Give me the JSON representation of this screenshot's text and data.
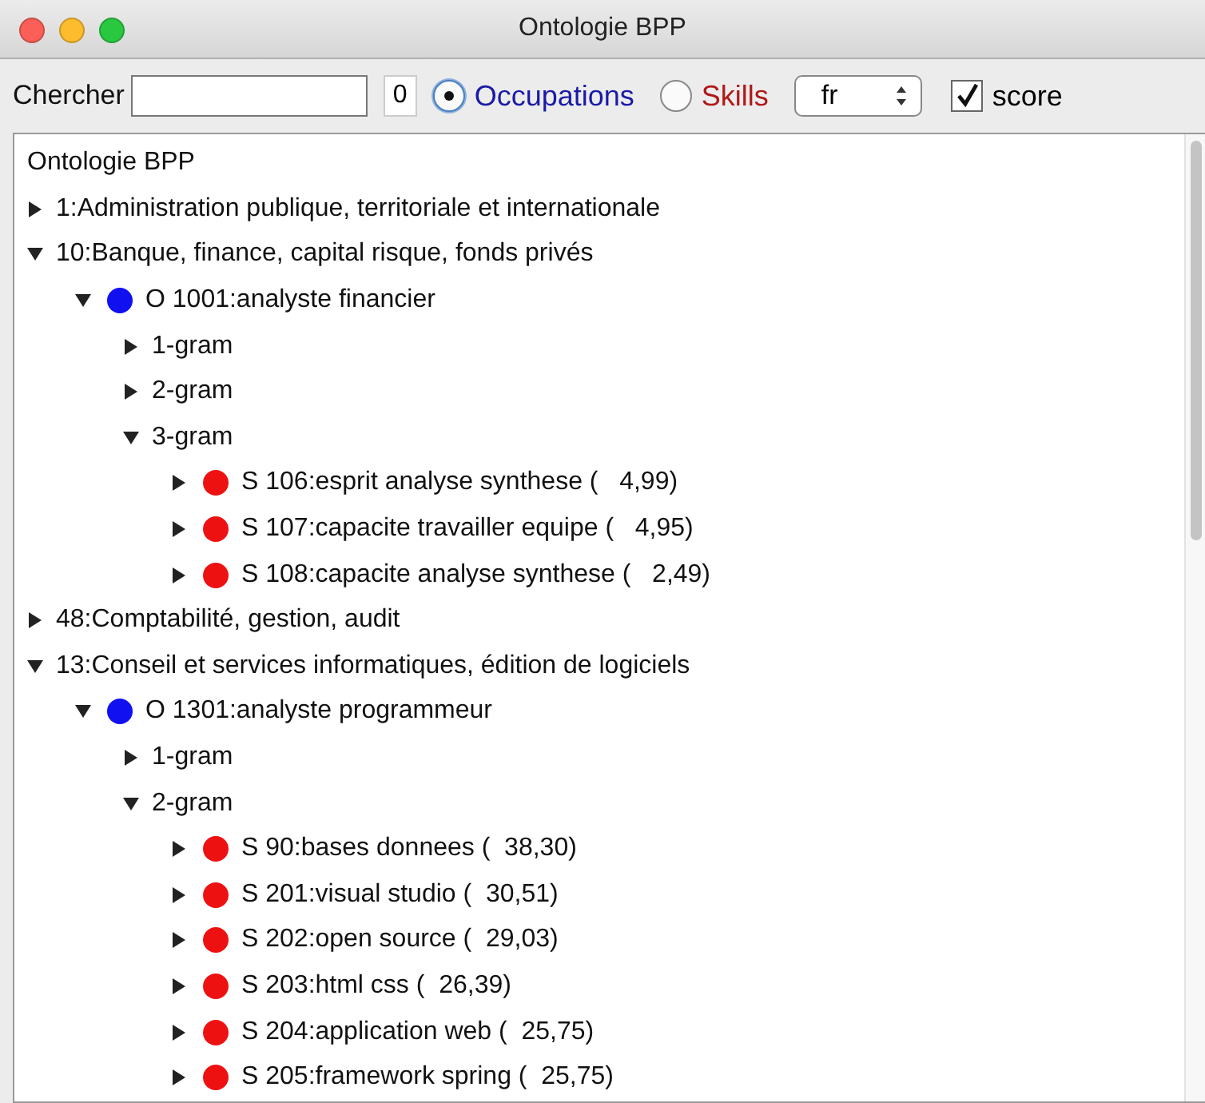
{
  "window": {
    "title": "Ontologie BPP"
  },
  "toolbar": {
    "search_label": "Chercher",
    "count": "0",
    "radios": [
      {
        "label": "Occupations",
        "selected": true,
        "color": "#1a1aa8"
      },
      {
        "label": "Skills",
        "selected": false,
        "color": "#b01818"
      }
    ],
    "language": "fr",
    "score": {
      "label": "score",
      "checked": true
    }
  },
  "tree": {
    "root": "Ontologie BPP",
    "children": [
      {
        "label": "1:Administration publique, territoriale et internationale",
        "expanded": false
      },
      {
        "label": "10:Banque, finance, capital risque, fonds privés",
        "expanded": true,
        "children": [
          {
            "label": "O 1001:analyste financier",
            "expanded": true,
            "color": "#1010f0",
            "children": [
              {
                "label": "1-gram",
                "expanded": false
              },
              {
                "label": "2-gram",
                "expanded": false
              },
              {
                "label": "3-gram",
                "expanded": true,
                "children": [
                  {
                    "label": "S 106:esprit analyse synthese (   4,99)",
                    "expanded": false,
                    "color": "#ee1111"
                  },
                  {
                    "label": "S 107:capacite travailler equipe (   4,95)",
                    "expanded": false,
                    "color": "#ee1111"
                  },
                  {
                    "label": "S 108:capacite analyse synthese (   2,49)",
                    "expanded": false,
                    "color": "#ee1111"
                  }
                ]
              }
            ]
          }
        ]
      },
      {
        "label": "48:Comptabilité, gestion, audit",
        "expanded": false
      },
      {
        "label": "13:Conseil et services informatiques, édition de logiciels",
        "expanded": true,
        "children": [
          {
            "label": "O 1301:analyste programmeur",
            "expanded": true,
            "color": "#1010f0",
            "children": [
              {
                "label": "1-gram",
                "expanded": false
              },
              {
                "label": "2-gram",
                "expanded": true,
                "children": [
                  {
                    "label": "S 90:bases donnees (  38,30)",
                    "expanded": false,
                    "color": "#ee1111"
                  },
                  {
                    "label": "S 201:visual studio (  30,51)",
                    "expanded": false,
                    "color": "#ee1111"
                  },
                  {
                    "label": "S 202:open source (  29,03)",
                    "expanded": false,
                    "color": "#ee1111"
                  },
                  {
                    "label": "S 203:html css (  26,39)",
                    "expanded": false,
                    "color": "#ee1111"
                  },
                  {
                    "label": "S 204:application web (  25,75)",
                    "expanded": false,
                    "color": "#ee1111"
                  },
                  {
                    "label": "S 205:framework spring (  25,75)",
                    "expanded": false,
                    "color": "#ee1111"
                  }
                ]
              }
            ]
          }
        ]
      }
    ]
  }
}
